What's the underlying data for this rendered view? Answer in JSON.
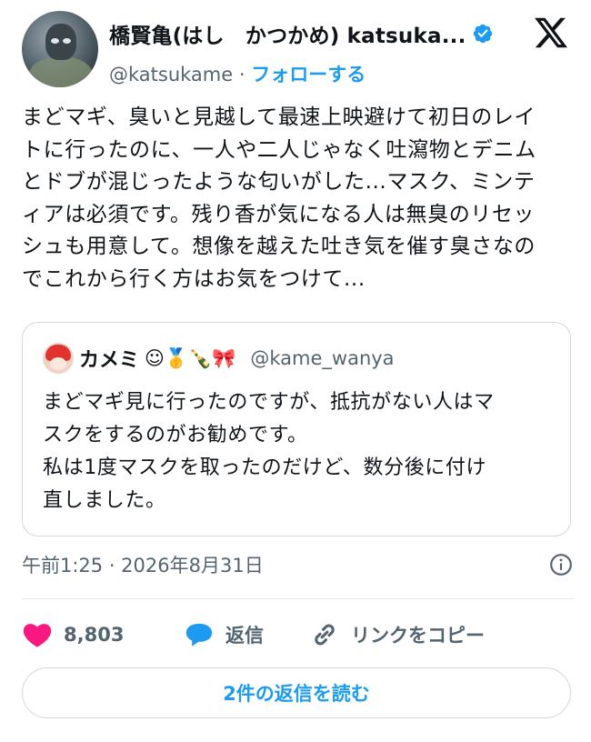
{
  "author": {
    "name": "橋賢亀(はし　かつかめ) katsuka...",
    "handle": "@katsukame",
    "separator": "·",
    "follow_label": "フォローする",
    "verified": true
  },
  "tweet": {
    "lines": [
      "まどマギ、臭いと見越して最速上映避けて初日のレイ",
      "トに行ったのに、一人や二人じゃなく吐瀉物とデニム",
      "とドブが混じったような匂いがした...マスク、ミンテ",
      "ィアは必須です。残り香が気になる人は無臭のリセッ",
      "シュも用意して。想像を越えた吐き気を催す臭さなの",
      "でこれから行く方はお気をつけて..."
    ]
  },
  "quote": {
    "name": "カメミ",
    "emojis": "☺🥇🍾🎀",
    "handle": "@kame_wanya",
    "lines": [
      "まどマギ見に行ったのですが、抵抗がない人はマ",
      "スクをするのがお勧めです。",
      "私は1度マスクを取ったのだけど、数分後に付け",
      "直しました。"
    ]
  },
  "timestamp": "午前1:25 · 2026年8月31日",
  "actions": {
    "like_count": "8,803",
    "reply_label": "返信",
    "copy_link_label": "リンクをコピー"
  },
  "read_replies_label": "2件の返信を読む",
  "colors": {
    "accent": "#1d9bf0",
    "like": "#f91880",
    "muted": "#536471",
    "text": "#0f1419",
    "border": "#cfd9de"
  },
  "icons": [
    "verified-badge-icon",
    "x-logo-icon",
    "info-icon",
    "heart-icon",
    "reply-bubble-icon",
    "link-icon"
  ]
}
